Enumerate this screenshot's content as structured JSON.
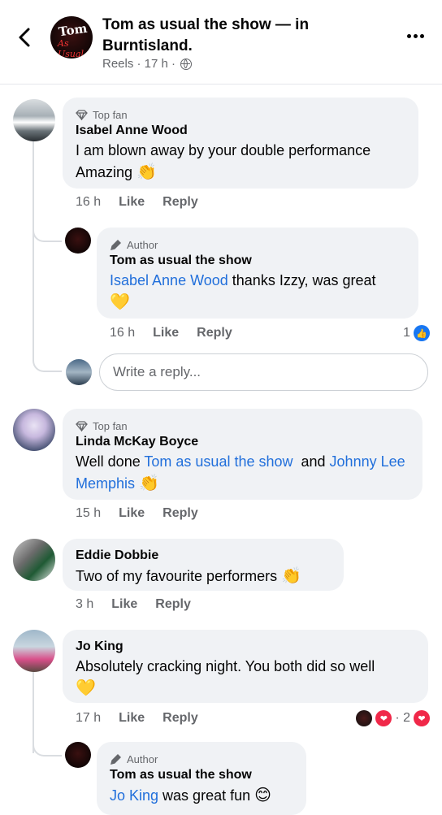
{
  "header": {
    "title": "Tom as usual the show — in Burntisland.",
    "subtitle": "Reels · 17 h ·",
    "avatar_text_top": "Tom",
    "avatar_text_bottom": "As Usual"
  },
  "comments": [
    {
      "badge": "Top fan",
      "name": "Isabel Anne Wood",
      "text": "I am blown away by your double performance Amazing",
      "emoji": "👏",
      "time": "16 h",
      "like": "Like",
      "reply": "Reply"
    },
    {
      "badge": "Author",
      "name": "Tom as usual the show",
      "mention": "Isabel Anne Wood",
      "text": " thanks Izzy, was great",
      "emoji": "💛",
      "time": "16 h",
      "like": "Like",
      "reply": "Reply",
      "reaction_count": "1"
    },
    {
      "badge": "Top fan",
      "name": "Linda McKay Boyce",
      "text_prefix": "Well done ",
      "mention1": "Tom as usual the show",
      "text_mid": "  and ",
      "mention2": "Johnny Lee Memphis",
      "emoji": "👏",
      "time": "15 h",
      "like": "Like",
      "reply": "Reply"
    },
    {
      "name": "Eddie Dobbie",
      "text": "Two of my favourite performers",
      "emoji": "👏",
      "time": "3 h",
      "like": "Like",
      "reply": "Reply"
    },
    {
      "name": "Jo King",
      "text": "Absolutely cracking night. You both did so well",
      "emoji": "💛",
      "time": "17 h",
      "like": "Like",
      "reply": "Reply",
      "reaction_count": "· 2"
    },
    {
      "badge": "Author",
      "name": "Tom as usual the show",
      "mention": "Jo King",
      "text": " was great fun",
      "emoji": "😊"
    }
  ],
  "reply_input": {
    "placeholder": "Write a reply..."
  },
  "colors": {
    "link": "#216fdb",
    "bubble": "#f0f2f5",
    "secondary_text": "#65676b",
    "like_blue": "#1877f2",
    "heart_red": "#f02849"
  }
}
